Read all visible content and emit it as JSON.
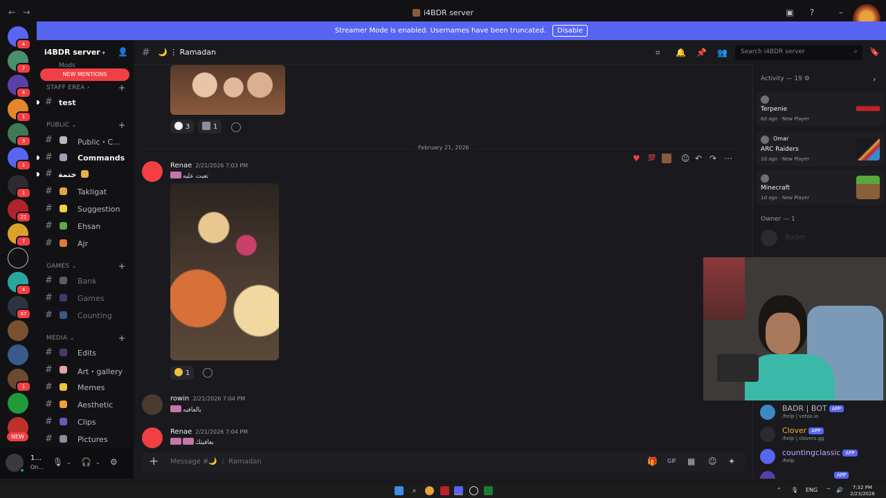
{
  "window": {
    "title": "i4BDR server"
  },
  "banner": {
    "text": "Streamer Mode is enabled. Usernames have been truncated.",
    "disable_label": "Disable"
  },
  "rail": {
    "new_label": "NEW"
  },
  "sidebar": {
    "server_name": "i4BDR server",
    "mods_label": "Mods",
    "new_mentions": "NEW MENTIONS",
    "categories": [
      {
        "label": "STAFF EREA",
        "channels": [
          {
            "name": "test"
          }
        ]
      },
      {
        "label": "PUBLIC",
        "channels": [
          {
            "name": "Public・C..."
          },
          {
            "name": "Commands"
          },
          {
            "name": "ختمة"
          },
          {
            "name": "Takligat"
          },
          {
            "name": "Suggestion"
          },
          {
            "name": "Ehsan"
          },
          {
            "name": "Ajr"
          }
        ]
      },
      {
        "label": "GAMES",
        "channels": [
          {
            "name": "Bank"
          },
          {
            "name": "Games"
          },
          {
            "name": "Counting"
          }
        ]
      },
      {
        "label": "MEDIA",
        "channels": [
          {
            "name": "Edits"
          },
          {
            "name": "Art・gallery"
          },
          {
            "name": "Memes"
          },
          {
            "name": "Aesthetic"
          },
          {
            "name": "Clips"
          },
          {
            "name": "Pictures"
          }
        ]
      }
    ],
    "user": {
      "name": "1...",
      "status": "On..."
    }
  },
  "header": {
    "channel": "Ramadan",
    "search_placeholder": "Search i4BDR server"
  },
  "messages": {
    "top_reactions": [
      {
        "count": "3"
      },
      {
        "count": "1"
      }
    ],
    "date_divider": "February 21, 2026",
    "items": [
      {
        "author": "Renae",
        "time": "2/21/2026 7:03 PM",
        "text": "تعبت عليه",
        "reaction_count": "1"
      },
      {
        "author": "rowin",
        "time": "2/21/2026 7:04 PM",
        "text": "بالعافيه"
      },
      {
        "author": "Renae",
        "time": "2/21/2026 7:04 PM",
        "text": "بعافيتك"
      }
    ]
  },
  "composer": {
    "placeholder": "Message #🌙 ⋮ Ramadan"
  },
  "activity": {
    "label": "Activity — 19",
    "items": [
      {
        "game": "Terpenie",
        "ago": "6d ago",
        "tag": "New Player"
      },
      {
        "user": "Omar",
        "game": "ARC Raiders",
        "ago": "2d ago",
        "tag": "New Player"
      },
      {
        "game": "Minecraft",
        "ago": "1d ago",
        "tag": "New Player"
      }
    ],
    "owner_label": "Owner — 1",
    "owner_name": "Bader"
  },
  "apps": [
    {
      "name": "BADR | BOT",
      "tag": "APP",
      "sub": "/help | vetox.io",
      "color": "#b5bac1"
    },
    {
      "name": "Clover",
      "tag": "APP",
      "sub": "/help | clovers.gg",
      "color": "#f0b232"
    },
    {
      "name": "countingclassic",
      "tag": "APP",
      "sub": "/help",
      "color": "#c4a6ff"
    },
    {
      "name": "",
      "tag": "APP",
      "sub": "",
      "color": "#f23f43"
    }
  ],
  "taskbar": {
    "lang": "ENG",
    "time": "7:32 PM",
    "date": "2/23/2026"
  },
  "colors": {
    "accent": "#5865f2",
    "danger": "#f23f43",
    "online": "#23a55a",
    "background": "#1a1a1e"
  }
}
